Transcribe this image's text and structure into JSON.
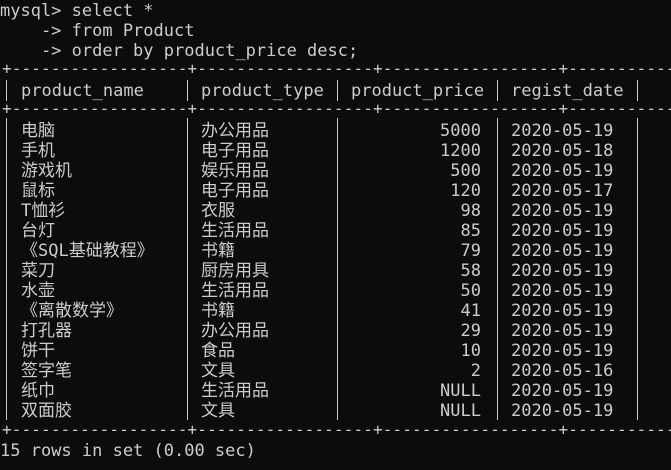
{
  "console": {
    "prompt": "mysql>",
    "query_lines": [
      "mysql> select *",
      "    -> from Product",
      "    -> order by product_price desc;"
    ],
    "border_top": "+------------------+------------------+------------------+------------------+",
    "border_mid": "+------------------+------------------+------------------+------------------+",
    "border_bottom": "+------------------+------------------+------------------+------------------+",
    "summary": "15 rows in set (0.00 sec)"
  },
  "table": {
    "columns": [
      "product_name",
      "product_type",
      "product_price",
      "regist_date"
    ],
    "rows": [
      [
        "电脑",
        "办公用品",
        "5000",
        "2020-05-19"
      ],
      [
        "手机",
        "电子用品",
        "1200",
        "2020-05-18"
      ],
      [
        "游戏机",
        "娱乐用品",
        "500",
        "2020-05-19"
      ],
      [
        "鼠标",
        "电子用品",
        "120",
        "2020-05-17"
      ],
      [
        "T恤衫",
        "衣服",
        "98",
        "2020-05-19"
      ],
      [
        "台灯",
        "生活用品",
        "85",
        "2020-05-19"
      ],
      [
        "《SQL基础教程》",
        "书籍",
        "79",
        "2020-05-19"
      ],
      [
        "菜刀",
        "厨房用具",
        "58",
        "2020-05-19"
      ],
      [
        "水壶",
        "生活用品",
        "50",
        "2020-05-19"
      ],
      [
        "《离散数学》",
        "书籍",
        "41",
        "2020-05-19"
      ],
      [
        "打孔器",
        "办公用品",
        "29",
        "2020-05-19"
      ],
      [
        "饼干",
        "食品",
        "10",
        "2020-05-19"
      ],
      [
        "签字笔",
        "文具",
        "2",
        "2020-05-16"
      ],
      [
        "纸巾",
        "生活用品",
        "NULL",
        "2020-05-19"
      ],
      [
        "双面胶",
        "文具",
        "NULL",
        "2020-05-19"
      ]
    ]
  },
  "colors": {
    "background": "#0c0c0c",
    "text": "#cccccc"
  }
}
